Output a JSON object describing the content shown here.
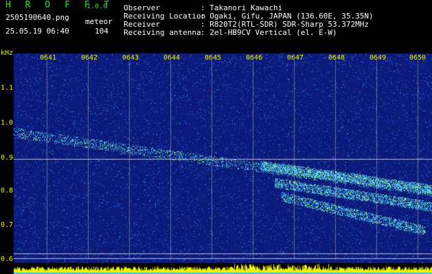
{
  "header": {
    "app_title": "H R O F F T",
    "version": "1.0.0",
    "filename": "2505190640.png",
    "datetime": "25.05.19 06:40",
    "event_label": "meteor",
    "event_count": "104",
    "info": [
      {
        "label": "Observer",
        "value": ": Takanori Kawachi"
      },
      {
        "label": "Receiving Location",
        "value": ": Ogaki, Gifu, JAPAN (136.60E, 35.35N)"
      },
      {
        "label": "Receiver",
        "value": ": R820T2(RTL-SDR) SDR-Sharp 53.372MHz"
      },
      {
        "label": "Receiving antenna",
        "value": ": 2el-HB9CV Vertical (el. E-W)"
      }
    ]
  },
  "spectrogram": {
    "unit_label": "kHz",
    "minutes": [
      "0641",
      "0642",
      "0643",
      "0644",
      "0645",
      "0646",
      "0647",
      "0648",
      "0649",
      "0650"
    ],
    "yticks": [
      "1.1",
      "1.0",
      "0.9",
      "0.8",
      "0.7",
      "0.6"
    ],
    "colors": {
      "background": "#0c1a7a",
      "noise": "#2d6cff",
      "signal": "#9fff7a",
      "grid": "#ffffff",
      "level": "#f0f000"
    }
  }
}
